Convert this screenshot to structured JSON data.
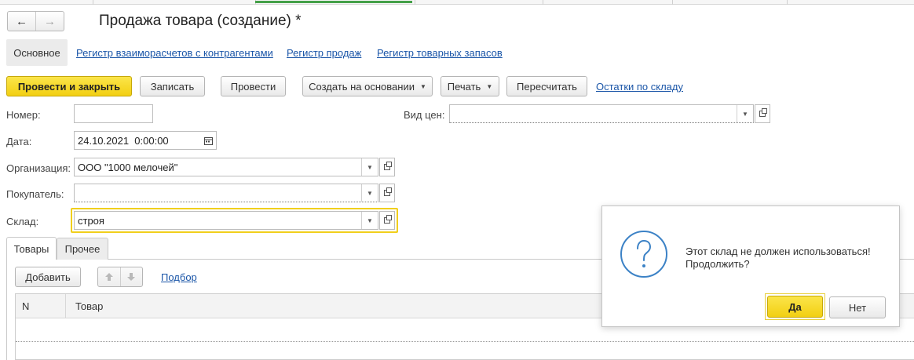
{
  "window": {
    "title": "Продажа товара (создание) *",
    "nav": {
      "back_icon": "←",
      "forward_icon": "→"
    }
  },
  "sections": {
    "main": "Основное",
    "links": [
      "Регистр взаиморасчетов с контрагентами",
      "Регистр продаж",
      "Регистр товарных запасов"
    ]
  },
  "toolbar": {
    "post_close": "Провести и закрыть",
    "save": "Записать",
    "post": "Провести",
    "create_based": "Создать на основании",
    "print": "Печать",
    "recalc": "Пересчитать",
    "stock_link": "Остатки по складу"
  },
  "form": {
    "number_label": "Номер:",
    "number_value": "",
    "date_label": "Дата:",
    "date_value": "24.10.2021  0:00:00",
    "org_label": "Организация:",
    "org_value": "ООО \"1000 мелочей\"",
    "buyer_label": "Покупатель:",
    "buyer_value": "",
    "warehouse_label": "Склад:",
    "warehouse_value": "строя",
    "price_type_label": "Вид цен:",
    "price_type_value": ""
  },
  "tabs": {
    "goods": "Товары",
    "other": "Прочее"
  },
  "goods_panel": {
    "add": "Добавить",
    "pick": "Подбор",
    "columns": [
      "N",
      "Товар"
    ]
  },
  "dialog": {
    "message": "Этот склад не должен использоваться!Продолжить?",
    "yes": "Да",
    "no": "Нет"
  },
  "colors": {
    "accent_yellow": "#f5d31a",
    "link_blue": "#1b56a8",
    "active_tab_green": "#45a049",
    "question_icon": "#3c82c6"
  }
}
